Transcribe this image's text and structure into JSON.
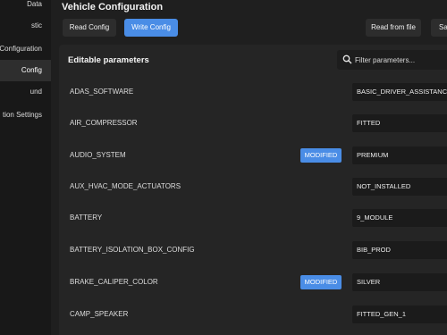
{
  "sidebar": {
    "items": [
      {
        "label": "Data",
        "active": false
      },
      {
        "label": "stic",
        "active": false
      },
      {
        "label": "Configuration",
        "active": false
      },
      {
        "label": "Config",
        "active": true
      },
      {
        "label": "und",
        "active": false
      },
      {
        "label": "tion Settings",
        "active": false
      }
    ]
  },
  "header": {
    "title": "Vehicle Configuration",
    "buttons": {
      "read_config": "Read Config",
      "write_config": "Write Config",
      "read_from_file": "Read from file",
      "save_partial": "Sa"
    }
  },
  "panel": {
    "title": "Editable parameters",
    "filter_placeholder": "Filter parameters...",
    "params": [
      {
        "name": "ADAS_SOFTWARE",
        "modified": "",
        "value": "BASIC_DRIVER_ASSISTANCE"
      },
      {
        "name": "AIR_COMPRESSOR",
        "modified": "",
        "value": "FITTED"
      },
      {
        "name": "AUDIO_SYSTEM",
        "modified": "MODIFIED",
        "value": "PREMIUM"
      },
      {
        "name": "AUX_HVAC_MODE_ACTUATORS",
        "modified": "",
        "value": "NOT_INSTALLED"
      },
      {
        "name": "BATTERY",
        "modified": "",
        "value": "9_MODULE"
      },
      {
        "name": "BATTERY_ISOLATION_BOX_CONFIG",
        "modified": "",
        "value": "BIB_PROD"
      },
      {
        "name": "BRAKE_CALIPER_COLOR",
        "modified": "MODIFIED",
        "value": "SILVER"
      },
      {
        "name": "CAMP_SPEAKER",
        "modified": "",
        "value": "FITTED_GEN_1"
      }
    ]
  },
  "colors": {
    "accent": "#4a8de6",
    "background": "#1f1f1f",
    "panel": "#252525"
  },
  "icons": {
    "filter": "search-icon"
  }
}
